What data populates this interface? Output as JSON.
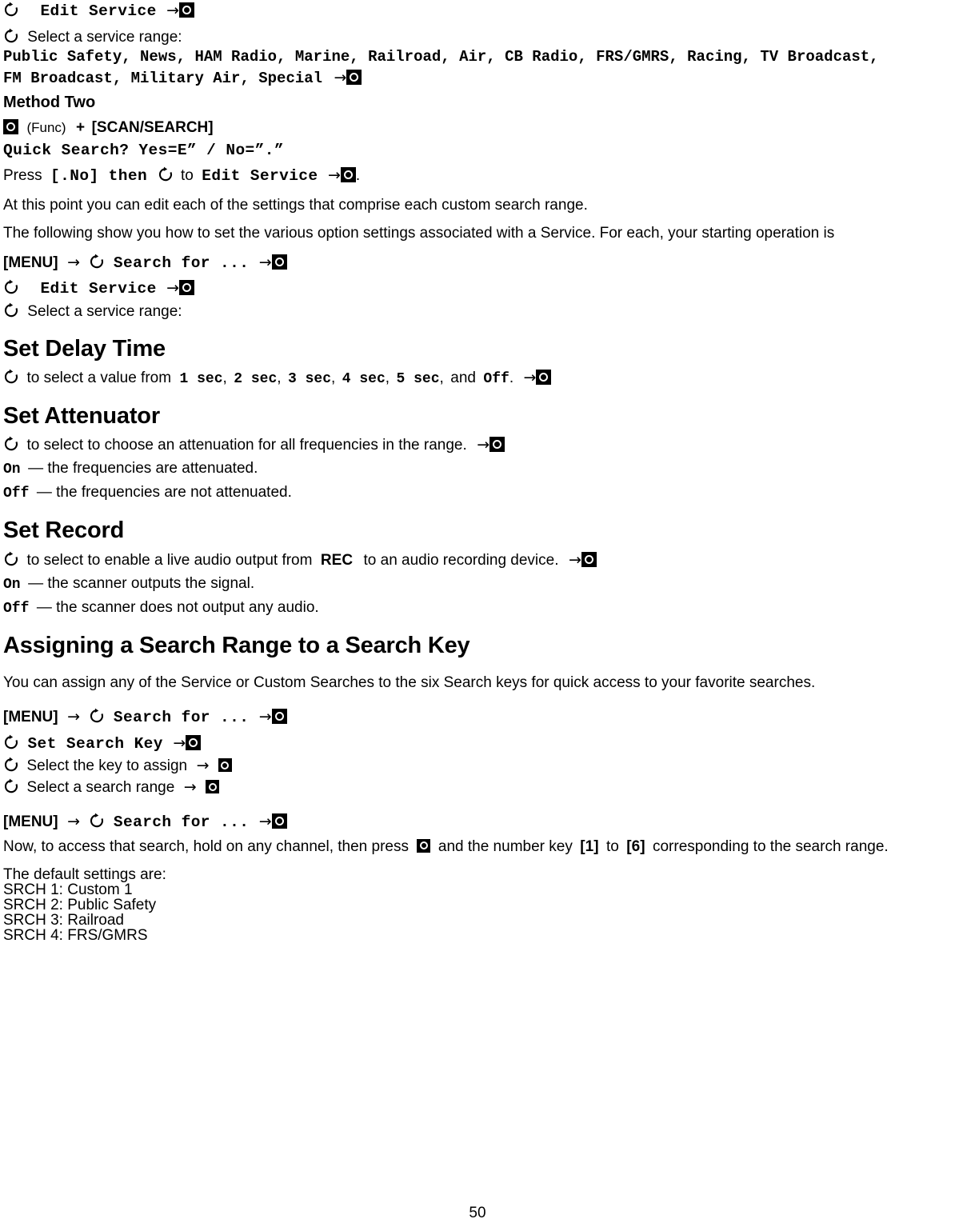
{
  "page": {
    "number": "50"
  },
  "icons": {
    "knob": "rotate-knob-icon",
    "e_button": "e-button-icon",
    "arrow": "right-arrow-icon",
    "arrow_glyph": "→"
  },
  "l1": {
    "label": "Edit Service"
  },
  "l2": {
    "text": "Select a service range:"
  },
  "l3": {
    "text": "Public Safety, News, HAM Radio, Marine, Railroad, Air, CB Radio, FRS/GMRS, Racing, TV Broadcast,"
  },
  "l4": {
    "text": "FM Broadcast, Military Air, Special"
  },
  "method_two": {
    "heading": "Method Two",
    "func_label": "(Func)",
    "plus": "+",
    "scan_search_key": "[SCAN/SEARCH]",
    "quick_search_prompt": "Quick Search? Yes=E” / No=”.”",
    "press_word": "Press",
    "press_key": "[.No] then",
    "press_to": "to",
    "press_target": "Edit Service",
    "period": "."
  },
  "para1": {
    "text": "At this point you can edit each of the settings that comprise each custom search range."
  },
  "para2": {
    "text": "The following show you how to set the various option settings associated with a Service. For each, your starting operation is"
  },
  "nav1": {
    "menu_key": "[MENU]",
    "search_for": "Search for ..."
  },
  "nav2": {
    "edit_service": "Edit Service"
  },
  "nav3": {
    "text": "Select a service range:"
  },
  "set_delay_time": {
    "heading": "Set Delay Time",
    "lead": "to select a value from",
    "values": [
      "1 sec",
      "2 sec",
      "3 sec",
      "4 sec",
      "5 sec"
    ],
    "and_word": "and",
    "off_value": "Off",
    "period": "."
  },
  "set_attenuator": {
    "heading": "Set Attenuator",
    "lead": "to select to choose an attenuation for all frequencies in the range.",
    "on_value": "On",
    "on_desc": "— the frequencies are attenuated.",
    "off_value": "Off",
    "off_desc": "— the frequencies are not attenuated."
  },
  "set_record": {
    "heading": "Set Record",
    "lead_a": "to select to enable a live audio output from",
    "rec_label": "REC",
    "lead_b": "to an audio recording device.",
    "on_value": "On",
    "on_desc": "— the scanner outputs the signal.",
    "off_value": "Off",
    "off_desc": "— the scanner does not output any audio."
  },
  "assigning": {
    "heading": "Assigning a Search Range to a Search Key",
    "intro": "You can assign any of the Service or Custom Searches to the six Search keys for quick access to your favorite searches.",
    "step1_menu": "[MENU]",
    "step1_search_for": "Search for ...",
    "step2_label": "Set Search Key",
    "step3_text": "Select the key to assign",
    "step4_text": "Select a search range",
    "step5_menu": "[MENU]",
    "step5_search_for": "Search for ...",
    "final_a": "Now, to access that search, hold on any channel, then press",
    "final_b": "and the number key",
    "final_key_1": "[1]",
    "final_to": "to",
    "final_key_6": "[6]",
    "final_c": "corresponding to the search range."
  },
  "defaults": {
    "intro": "The default settings are:",
    "items": [
      "SRCH 1: Custom 1",
      "SRCH 2: Public Safety",
      "SRCH 3: Railroad",
      "SRCH 4: FRS/GMRS"
    ]
  }
}
